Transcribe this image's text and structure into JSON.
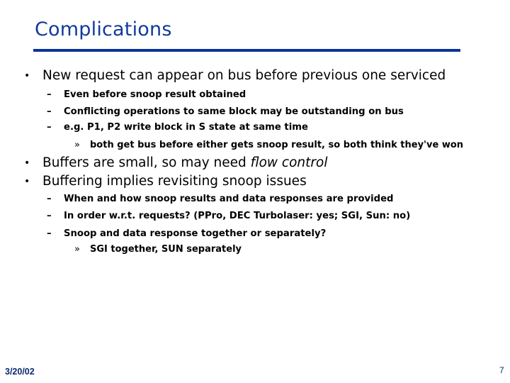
{
  "slide": {
    "title": "Complications",
    "colors": {
      "title": "#123a9c",
      "rule": "#0b3399",
      "footer": "#0d2a6e"
    },
    "bullet_glyph": "•",
    "dash_glyph": "–",
    "sub_glyph": "»",
    "items": [
      {
        "text": "New request can appear on bus before previous one serviced"
      },
      {
        "text": "Even before snoop result obtained"
      },
      {
        "text": "Conflicting operations to same block may be outstanding on bus"
      },
      {
        "text": "e.g. P1, P2 write block in S state at same time"
      },
      {
        "text": "both get bus before either gets snoop result, so both think they've won"
      },
      {
        "text_plain": "Buffers are small, so may need ",
        "text_emph": "flow control"
      },
      {
        "text": "Buffering implies revisiting snoop issues"
      },
      {
        "text": "When and how snoop results and data responses are provided"
      },
      {
        "text": "In order w.r.t. requests? (PPro, DEC Turbolaser: yes; SGI, Sun: no)"
      },
      {
        "text": "Snoop and data response together or separately?"
      },
      {
        "text": "SGI together, SUN separately"
      }
    ],
    "footer": {
      "date": "3/20/02",
      "page": "7"
    }
  }
}
